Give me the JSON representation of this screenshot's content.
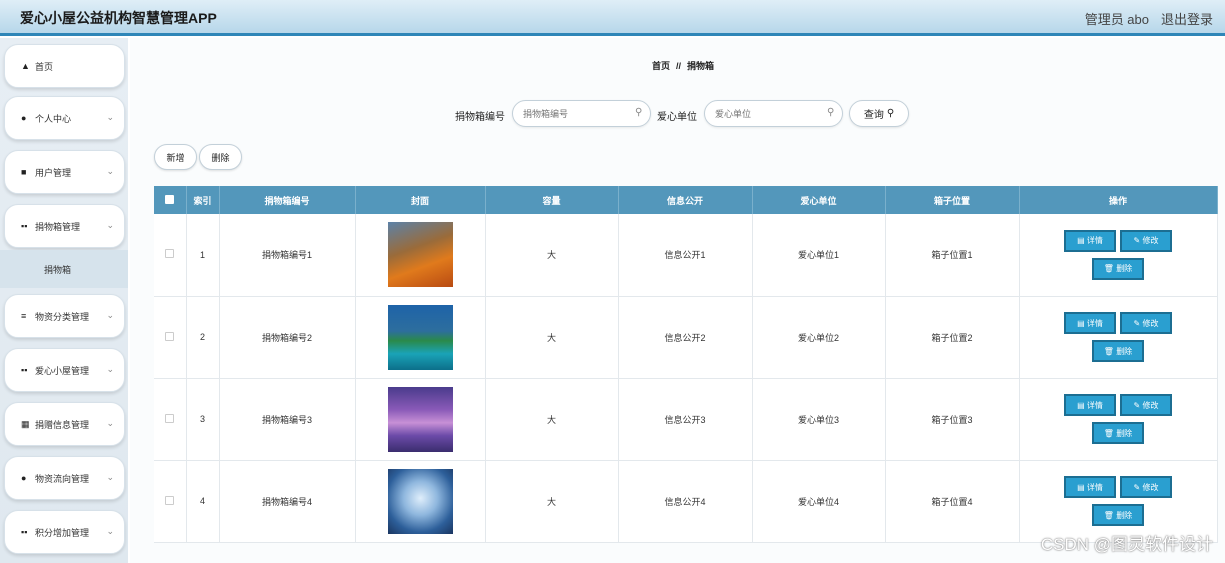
{
  "header": {
    "title": "爱心小屋公益机构智慧管理APP",
    "user": "管理员 abo",
    "logout": "退出登录"
  },
  "sidebar": {
    "items": [
      {
        "label": "首页",
        "icon": "home-icon"
      },
      {
        "label": "个人中心",
        "icon": "user-icon"
      },
      {
        "label": "用户管理",
        "icon": "user-card-icon"
      },
      {
        "label": "捐物箱管理",
        "icon": "grid-icon",
        "sub": "捐物箱"
      },
      {
        "label": "物资分类管理",
        "icon": "list-icon"
      },
      {
        "label": "爱心小屋管理",
        "icon": "grid-icon"
      },
      {
        "label": "捐赠信息管理",
        "icon": "table-icon"
      },
      {
        "label": "物资流向管理",
        "icon": "location-icon"
      },
      {
        "label": "积分增加管理",
        "icon": "grid-icon"
      }
    ]
  },
  "breadcrumb": {
    "home": "首页",
    "sep": "//",
    "current": "捐物箱"
  },
  "search": {
    "label1": "捐物箱编号",
    "placeholder1": "捐物箱编号",
    "label2": "爱心单位",
    "placeholder2": "爱心单位",
    "button": "查询"
  },
  "actions": {
    "add": "新增",
    "delete": "删除"
  },
  "table": {
    "headers": [
      "",
      "索引",
      "捐物箱编号",
      "封面",
      "容量",
      "信息公开",
      "爱心单位",
      "箱子位置",
      "操作"
    ],
    "rows": [
      {
        "index": "1",
        "code": "捐物箱编号1",
        "capacity": "大",
        "info": "信息公开1",
        "unit": "爱心单位1",
        "location": "箱子位置1"
      },
      {
        "index": "2",
        "code": "捐物箱编号2",
        "capacity": "大",
        "info": "信息公开2",
        "unit": "爱心单位2",
        "location": "箱子位置2"
      },
      {
        "index": "3",
        "code": "捐物箱编号3",
        "capacity": "大",
        "info": "信息公开3",
        "unit": "爱心单位3",
        "location": "箱子位置3"
      },
      {
        "index": "4",
        "code": "捐物箱编号4",
        "capacity": "大",
        "info": "信息公开4",
        "unit": "爱心单位4",
        "location": "箱子位置4"
      }
    ],
    "op_detail": "详情",
    "op_edit": "修改",
    "op_delete": "删除"
  },
  "watermark": "CSDN @图灵软件设计"
}
